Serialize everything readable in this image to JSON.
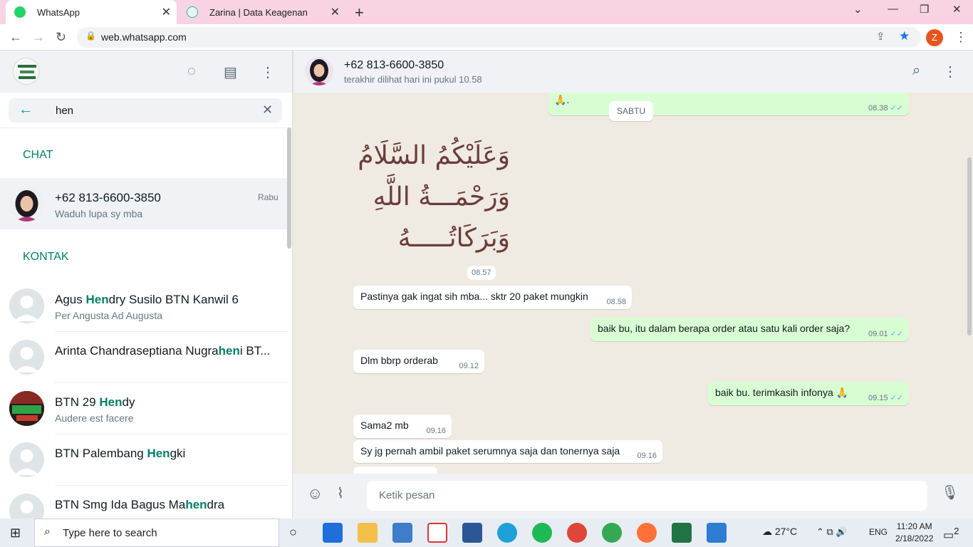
{
  "browser": {
    "tabs": [
      {
        "label": "WhatsApp",
        "favicon": "whatsapp-icon",
        "active": true
      },
      {
        "label": "Zarina | Data Keagenan",
        "favicon": "zarina-icon",
        "active": false
      }
    ],
    "url": "web.whatsapp.com",
    "profile_initial": "Z"
  },
  "sidebar": {
    "search_value": "hen",
    "section_chat": "CHAT",
    "section_contacts": "KONTAK",
    "chats": [
      {
        "title": "+62 813-6600-3850",
        "subtitle": "Waduh lupa sy mba",
        "time": "Rabu"
      }
    ],
    "contacts": [
      {
        "pre": "Agus ",
        "match": "Hen",
        "post": "dry Susilo BTN Kanwil 6",
        "subtitle": "Per Angusta Ad Augusta"
      },
      {
        "pre": "Arinta Chandraseptiana Nugra",
        "match": "hen",
        "post": "i BT...",
        "subtitle": ""
      },
      {
        "pre": "BTN 29 ",
        "match": "Hen",
        "post": "dy",
        "subtitle": "Audere est facere"
      },
      {
        "pre": "BTN Palembang ",
        "match": "Hen",
        "post": "gki",
        "subtitle": ""
      },
      {
        "pre": "BTN Smg Ida Bagus Ma",
        "match": "hen",
        "post": "dra",
        "subtitle": ""
      }
    ]
  },
  "conversation": {
    "contact": "+62 813-6600-3850",
    "last_seen": "terakhir dilihat hari ini pukul 10.58",
    "top_partial_time": "08.38",
    "day_chip": "SABTU",
    "sticker_lines": [
      "وَعَلَيْكُمُ السَّلَامُ",
      "وَرَحْمَـــةُ اللَّهِ",
      "وَبَرَكَاتُـــــهُ"
    ],
    "sticker_time": "08.57",
    "messages": [
      {
        "dir": "in",
        "text": "Pastinya gak ingat sih mba... sktr 20 paket mungkin",
        "time": "08.58"
      },
      {
        "dir": "out",
        "text": "baik bu, itu dalam berapa order atau satu kali order saja?",
        "time": "09.01"
      },
      {
        "dir": "in",
        "text": "Dlm bbrp orderab",
        "time": "09.12"
      },
      {
        "dir": "out",
        "text": "baik bu. terimkasih infonya 🙏",
        "time": "09.15"
      },
      {
        "dir": "in",
        "text": "Sama2 mb",
        "time": "09.16"
      },
      {
        "dir": "in",
        "text": "Sy jg pernah ambil paket serumnya saja dan tonernya saja",
        "time": "09.16"
      }
    ],
    "input_placeholder": "Ketik pesan"
  },
  "taskbar": {
    "search_placeholder": "Type here to search",
    "weather": "27°C",
    "language": "ENG",
    "time": "11:20 AM",
    "date": "2/18/2022",
    "notifications": "2"
  }
}
